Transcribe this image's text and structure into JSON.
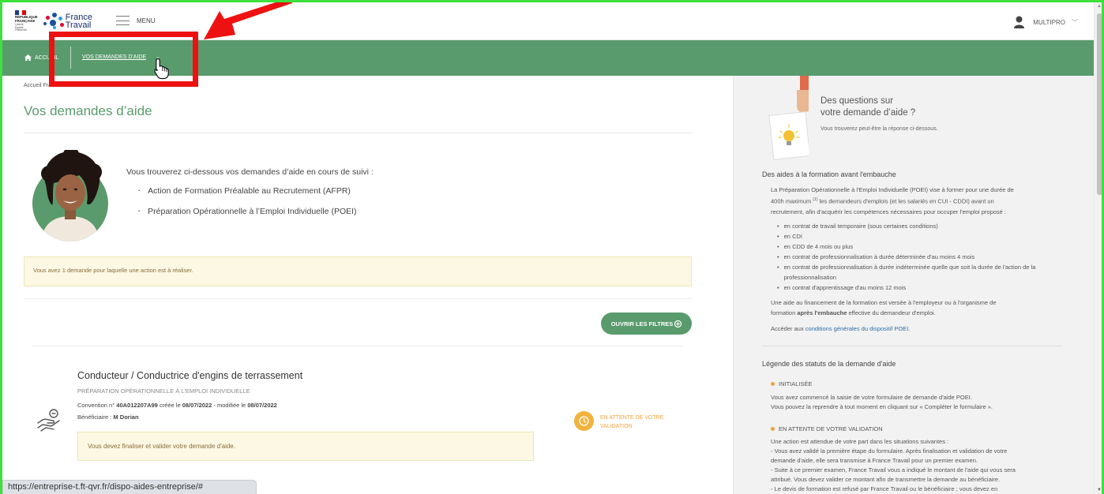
{
  "header": {
    "gov_logo": {
      "title": "RÉPUBLIQUE FRANÇAISE",
      "motto": "Liberté Égalité Fraternité"
    },
    "brand": {
      "line1": "France",
      "line2": "Travail"
    },
    "menu_label": "MENU",
    "user_label": "MULTIPRO"
  },
  "nav": {
    "home_label": "ACCUEIL",
    "link_label": "VOS DEMANDES D'AIDE"
  },
  "breadcrumb": "Accueil France Travail",
  "main": {
    "title": "Vos demandes d’aide",
    "intro": "Vous trouverez ci-dessous vos demandes d’aide en cours de suivi :",
    "aid_types": [
      "Action de Formation Préalable au Recrutement (AFPR)",
      "Préparation Opérationnelle à l’Emploi Individuelle (POEI)"
    ],
    "notice": "Vous avez 1 demande pour laquelle une action est à réaliser.",
    "filters_button": "OUVRIR LES FILTRES"
  },
  "request": {
    "title": "Conducteur / Conductrice d'engins de terrassement",
    "type": "PRÉPARATION OPÉRATIONNELLE À L'EMPLOI INDIVIDUELLE",
    "convention_prefix": "Convention n°",
    "convention_number": "40A012207A99",
    "created_label": "créée le",
    "created_date": "08/07/2022",
    "modified_label": "- modifiée le",
    "modified_date": "08/07/2022",
    "beneficiary_label": "Bénéficiaire :",
    "beneficiary_name": "M Dorian",
    "status": "EN ATTENTE DE VOTRE VALIDATION",
    "notice": "Vous devez finaliser et valider votre demande d'aide."
  },
  "status_url": "https://entreprise-t.ft-qvr.fr/dispo-aides-entreprise/#",
  "sidebar": {
    "question_line1": "Des questions sur",
    "question_line2": "votre demande d’aide ?",
    "question_sub": "Vous trouverez peut-être la réponse ci-dessous.",
    "section1_title": "Des aides à la formation avant l'embauche",
    "section1_p1_a": "La Préparation Opérationnelle à l'Emploi Individuelle (POEI) vise à former pour une durée de",
    "section1_p1_b": "400h maximum",
    "section1_p1_sup": "(1)",
    "section1_p1_c": "les demandeurs d'emplois (et les salariés en CUI - CDDI) avant un",
    "section1_p1_d": "recrutement, afin d'acquérir les compétences nécessaires pour occuper l'emploi proposé :",
    "contracts": [
      "en contrat de travail temporaire (sous certaines conditions)",
      "en CDI",
      "en CDD de 4 mois ou plus",
      "en contrat de professionnalisation à durée déterminée d'au moins 4 mois",
      "en contrat de professionnalisation à durée indéterminée quelle que soit la durée de l'action de la professionnalisation",
      "en contrat d'apprentissage d'au moins 12 mois"
    ],
    "section1_p2_a": "Une aide au financement de la formation est versée à l'employeur ou à l'organisme de",
    "section1_p2_b": "formation",
    "section1_p2_strong": "après l'embauche",
    "section1_p2_c": "effective du demandeur d'emploi.",
    "access_prefix": "Accéder aux",
    "access_link": "conditions générales du dispositif POEI",
    "section2_title": "Légende des statuts de la demande d'aide",
    "status1_label": "INITIALISÉE",
    "status1_text1": "Vous avez commencé la saisie de votre formulaire de demande d'aide POEI.",
    "status1_text2": "Vous pouvez la reprendre à tout moment en cliquant sur « Compléter le formulaire ».",
    "status2_label": "EN ATTENTE DE VOTRE VALIDATION",
    "status2_text1": "Une action est attendue de votre part dans les situations suivantes :",
    "status2_text2": "- Vous avez validé la première étape du formulaire. Après finalisation et validation de votre",
    "status2_text3": "demande d'aide, elle sera transmise à France Travail pour un premier examen.",
    "status2_text4": "- Suite à ce premier examen, France Travail vous a indiqué le montant de l'aide qui vous sera",
    "status2_text5": "attribué. Vous devez valider ce montant afin de transmettre la demande au bénéficiaire.",
    "status2_text6": "- Le devis de formation est refusé par France Travail ou le bénéficiaire ; vous devez en"
  },
  "colors": {
    "brand_green": "#5a9b6d",
    "status_orange": "#f2a33d",
    "annotation_red": "#ee1111",
    "notice_bg": "#fcf8e3"
  }
}
